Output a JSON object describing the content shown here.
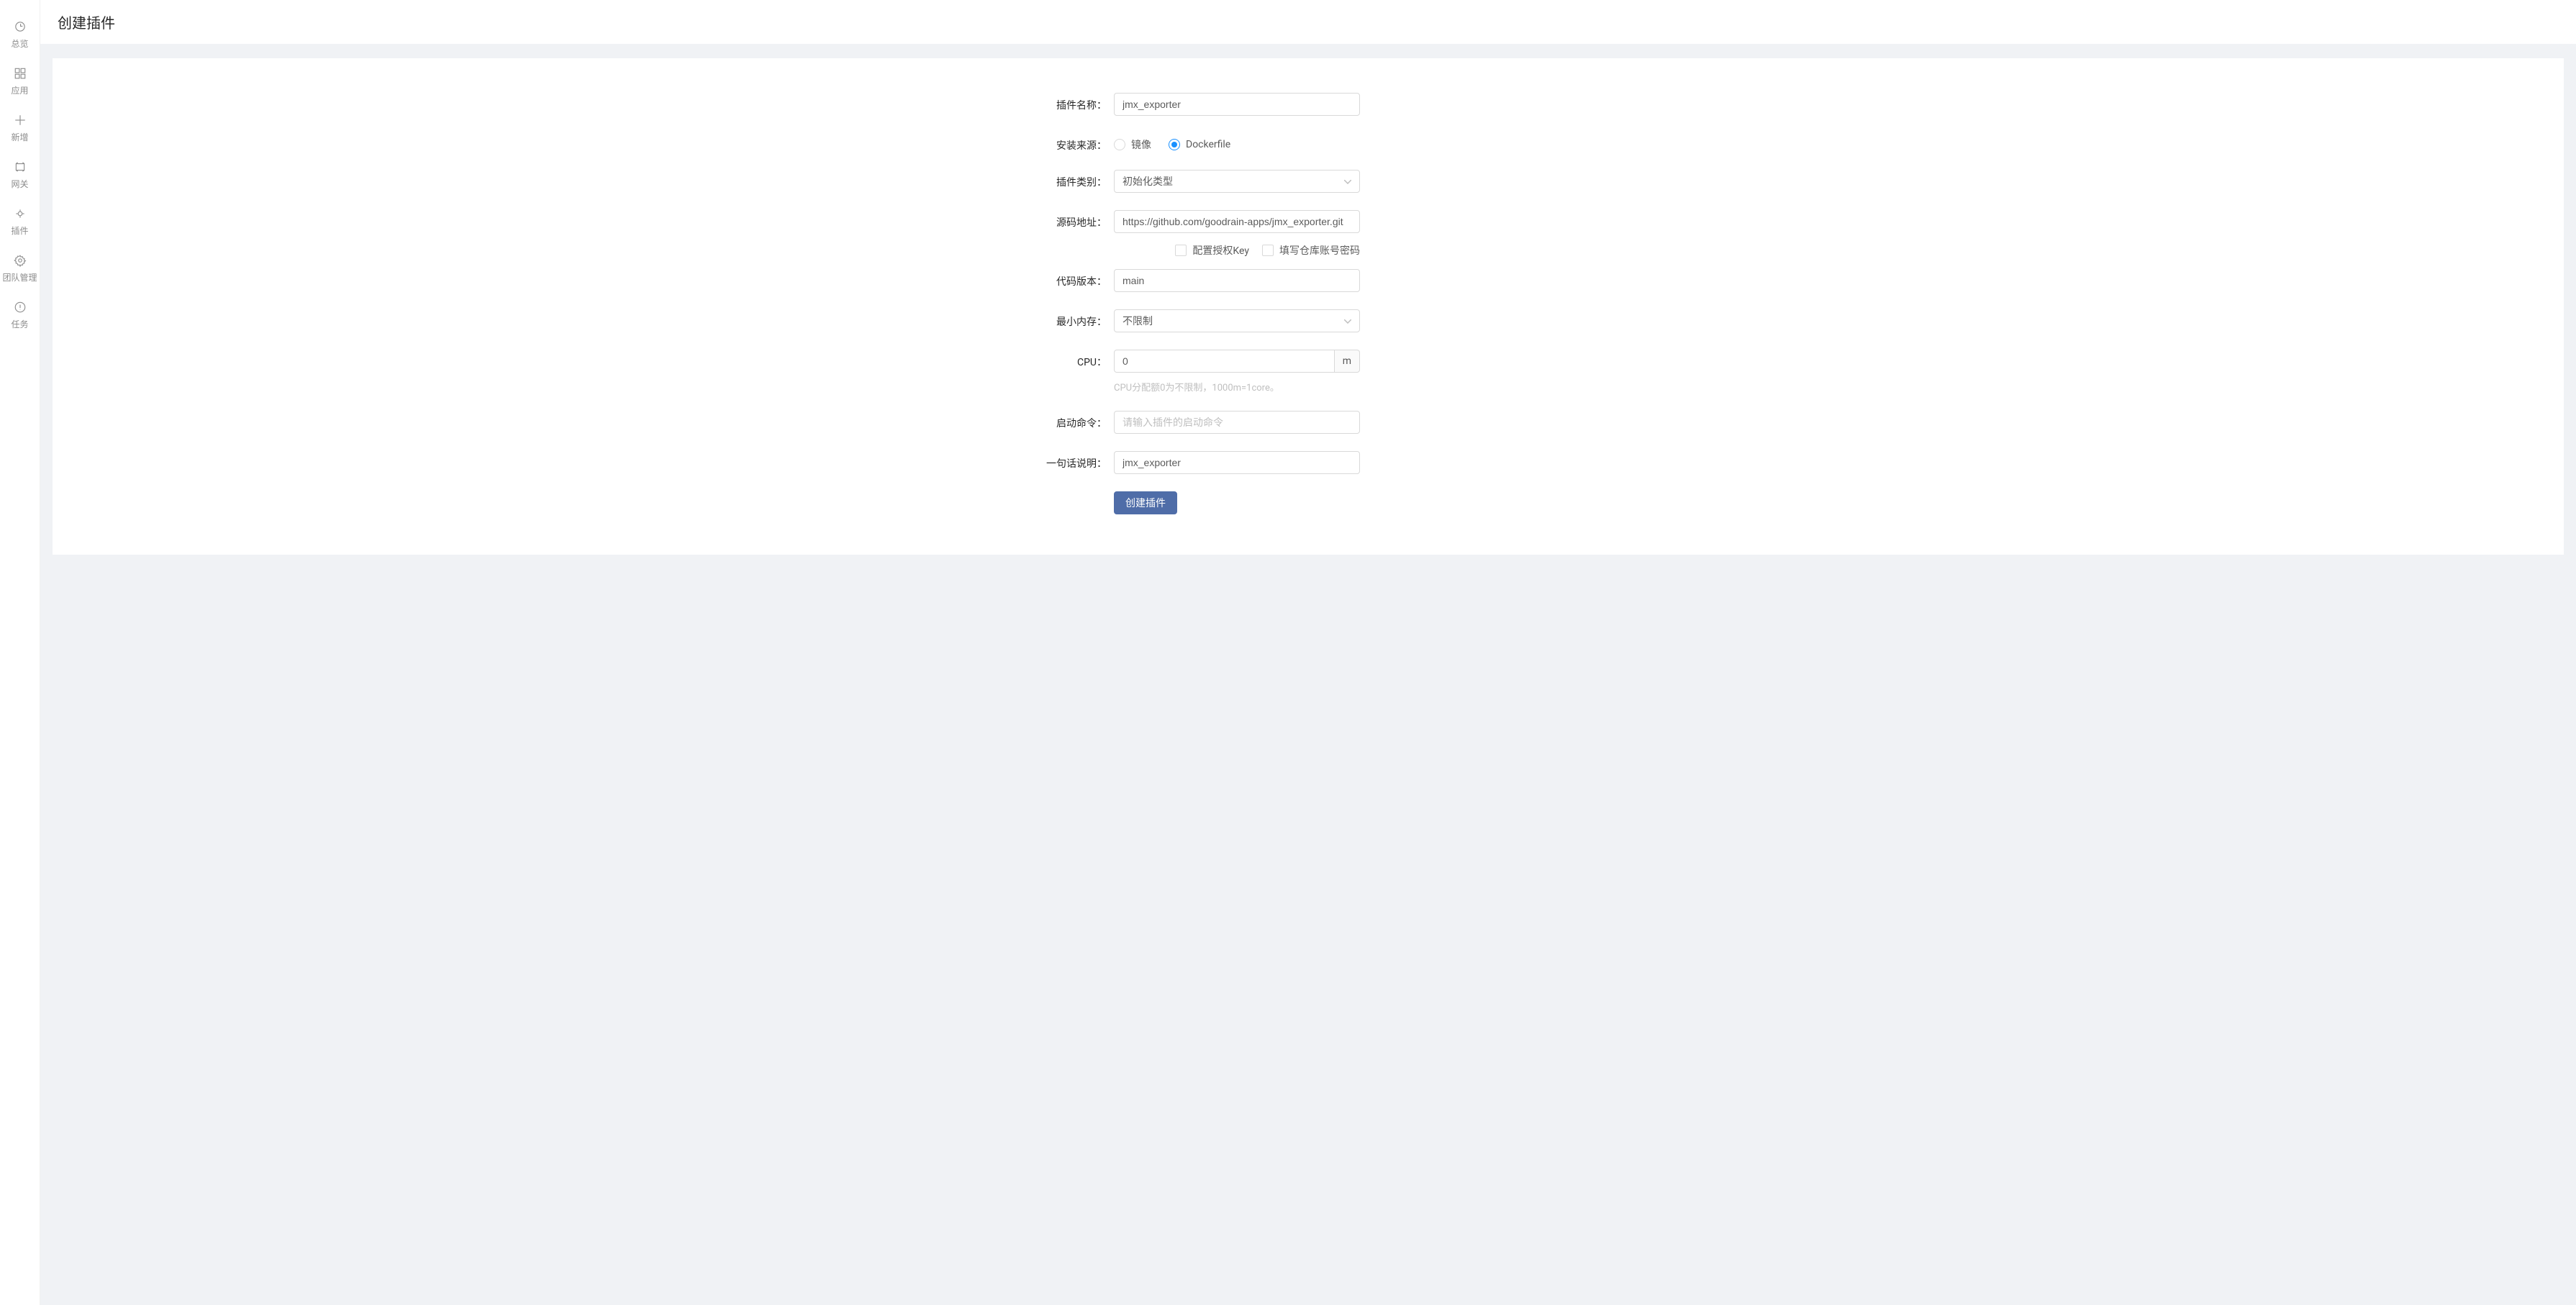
{
  "sidebar": {
    "items": [
      {
        "label": "总览"
      },
      {
        "label": "应用"
      },
      {
        "label": "新增"
      },
      {
        "label": "网关"
      },
      {
        "label": "插件"
      },
      {
        "label": "团队管理"
      },
      {
        "label": "任务"
      }
    ]
  },
  "header": {
    "title": "创建插件"
  },
  "form": {
    "plugin_name": {
      "label": "插件名称：",
      "value": "jmx_exporter"
    },
    "install_source": {
      "label": "安装来源：",
      "options": [
        {
          "label": "镜像",
          "checked": false
        },
        {
          "label": "Dockerfile",
          "checked": true
        }
      ]
    },
    "plugin_type": {
      "label": "插件类别：",
      "value": "初始化类型"
    },
    "source_url": {
      "label": "源码地址：",
      "value": "https://github.com/goodrain-apps/jmx_exporter.git"
    },
    "auth_options": {
      "config_key": "配置授权Key",
      "fill_repo_auth": "填写仓库账号密码"
    },
    "code_version": {
      "label": "代码版本：",
      "value": "main"
    },
    "min_memory": {
      "label": "最小内存：",
      "value": "不限制"
    },
    "cpu": {
      "label": "CPU：",
      "value": "0",
      "addon": "m",
      "help": "CPU分配额0为不限制，1000m=1core。"
    },
    "start_cmd": {
      "label": "启动命令：",
      "value": "",
      "placeholder": "请输入插件的启动命令"
    },
    "description": {
      "label": "一句话说明：",
      "value": "jmx_exporter"
    },
    "submit": "创建插件"
  }
}
